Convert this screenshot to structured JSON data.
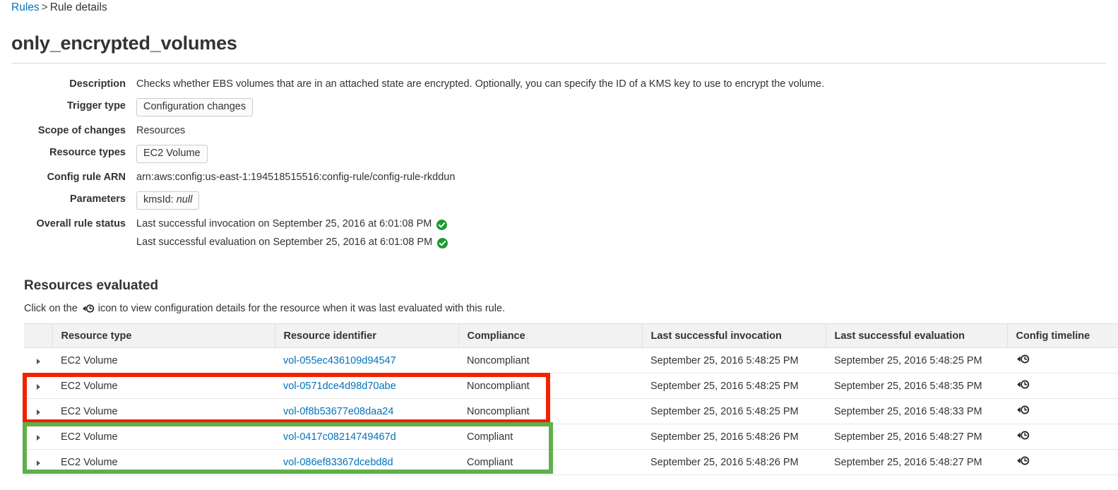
{
  "breadcrumb": {
    "root_label": "Rules",
    "separator": ">",
    "current_label": "Rule details"
  },
  "page_title": "only_encrypted_volumes",
  "details": {
    "description_label": "Description",
    "description_value": "Checks whether EBS volumes that are in an attached state are encrypted. Optionally, you can specify the ID of a KMS key to use to encrypt the volume.",
    "trigger_type_label": "Trigger type",
    "trigger_type_value": "Configuration changes",
    "scope_label": "Scope of changes",
    "scope_value": "Resources",
    "resource_types_label": "Resource types",
    "resource_types_value": "EC2 Volume",
    "arn_label": "Config rule ARN",
    "arn_value": "arn:aws:config:us-east-1:194518515516:config-rule/config-rule-rkddun",
    "parameters_label": "Parameters",
    "parameters_key": "kmsId:",
    "parameters_value": "null",
    "status_label": "Overall rule status",
    "status_invocation": "Last successful invocation on September 25, 2016 at 6:01:08 PM",
    "status_evaluation": "Last successful evaluation on September 25, 2016 at 6:01:08 PM",
    "status_icon": "green-check-icon"
  },
  "resources_section": {
    "heading": "Resources evaluated",
    "hint_prefix": "Click on the",
    "hint_icon": "config-timeline-icon",
    "hint_suffix": "icon to view configuration details for the resource when it was last evaluated with this rule."
  },
  "table": {
    "columns": [
      "Resource type",
      "Resource identifier",
      "Compliance",
      "Last successful invocation",
      "Last successful evaluation",
      "Config timeline"
    ],
    "rows": [
      {
        "expander": "expand-arrow-icon",
        "resource_type": "EC2 Volume",
        "resource_identifier": "vol-055ec436109d94547",
        "compliance": "Noncompliant",
        "compliance_state": "noncompliant",
        "last_invocation": "September 25, 2016 5:48:25 PM",
        "last_evaluation": "September 25, 2016 5:48:25 PM",
        "timeline_icon": "config-timeline-icon"
      },
      {
        "expander": "expand-arrow-icon",
        "resource_type": "EC2 Volume",
        "resource_identifier": "vol-0571dce4d98d70abe",
        "compliance": "Noncompliant",
        "compliance_state": "noncompliant",
        "last_invocation": "September 25, 2016 5:48:25 PM",
        "last_evaluation": "September 25, 2016 5:48:35 PM",
        "timeline_icon": "config-timeline-icon"
      },
      {
        "expander": "expand-arrow-icon",
        "resource_type": "EC2 Volume",
        "resource_identifier": "vol-0f8b53677e08daa24",
        "compliance": "Noncompliant",
        "compliance_state": "noncompliant",
        "last_invocation": "September 25, 2016 5:48:25 PM",
        "last_evaluation": "September 25, 2016 5:48:33 PM",
        "timeline_icon": "config-timeline-icon"
      },
      {
        "expander": "expand-arrow-icon",
        "resource_type": "EC2 Volume",
        "resource_identifier": "vol-0417c08214749467d",
        "compliance": "Compliant",
        "compliance_state": "compliant",
        "last_invocation": "September 25, 2016 5:48:26 PM",
        "last_evaluation": "September 25, 2016 5:48:27 PM",
        "timeline_icon": "config-timeline-icon"
      },
      {
        "expander": "expand-arrow-icon",
        "resource_type": "EC2 Volume",
        "resource_identifier": "vol-086ef83367dcebd8d",
        "compliance": "Compliant",
        "compliance_state": "compliant",
        "last_invocation": "September 25, 2016 5:48:26 PM",
        "last_evaluation": "September 25, 2016 5:48:27 PM",
        "timeline_icon": "config-timeline-icon"
      }
    ]
  },
  "annotations": [
    {
      "name": "red-highlight-box",
      "color": "#f52000",
      "covers_rows": [
        2,
        3
      ]
    },
    {
      "name": "green-highlight-box",
      "color": "#5db04a",
      "covers_rows": [
        4,
        5
      ]
    }
  ],
  "colors": {
    "link": "#0073bb",
    "noncompliant": "#d13212",
    "compliant": "#1d8102",
    "check": "#1d8102",
    "annotation_red": "#f52000",
    "annotation_green": "#5db04a"
  }
}
